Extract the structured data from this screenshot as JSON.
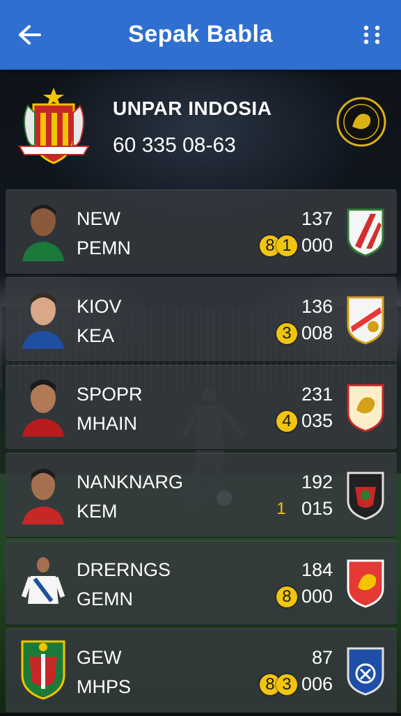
{
  "app": {
    "title": "Sepak Babla"
  },
  "club": {
    "name": "UNPAR INDOSIA",
    "code": "60 335 08-63"
  },
  "rows": [
    {
      "line1": "NEW",
      "line2": "PEMN",
      "points": "137",
      "coins": [
        "8",
        "1"
      ],
      "tail": "000",
      "badge_color": "#d32f2f"
    },
    {
      "line1": "KIOV",
      "line2": "KEA",
      "points": "136",
      "coins": [
        "3"
      ],
      "tail": "008",
      "badge_color": "#e53935"
    },
    {
      "line1": "SPOPR",
      "line2": "MHAIN",
      "points": "231",
      "coins": [
        "4"
      ],
      "tail": "035",
      "badge_color": "#c62828"
    },
    {
      "line1": "NANKNARG",
      "line2": "KEM",
      "points": "192",
      "coins": [
        "1"
      ],
      "tail": "015",
      "badge_color": "#212121"
    },
    {
      "line1": "DRERNGS",
      "line2": "GEMN",
      "points": "184",
      "coins": [
        "8"
      ],
      "tail": "000",
      "badge_color": "#e53935"
    },
    {
      "line1": "GEW",
      "line2": "MHPS",
      "points": "87",
      "coins": [
        "8",
        "3"
      ],
      "tail": "006",
      "badge_color": "#1e4fa8"
    }
  ],
  "colors": {
    "appbar": "#2f6fd0",
    "coin": "#f1c40f"
  },
  "icons": {
    "back": "arrow-left-icon",
    "menu": "more-vertical-icon"
  }
}
